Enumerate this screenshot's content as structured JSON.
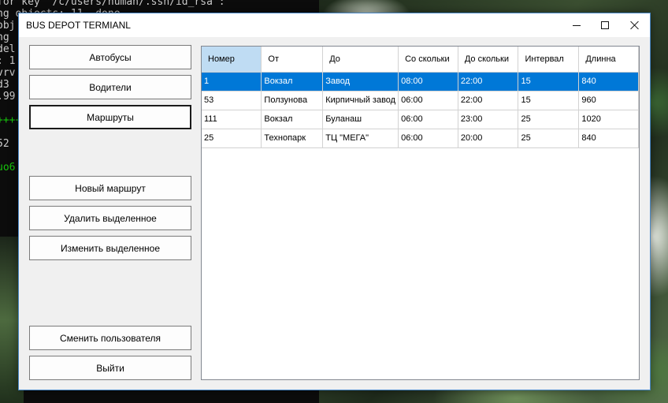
{
  "terminal": {
    "lines": [
      "for key '/c/users/human/.ssh/id_rsa':",
      "ng objects: 11, done.",
      "obj",
      "ng",
      "del",
      ": 1",
      "vrv",
      "d3",
      ".99",
      "++++",
      "52",
      "uo6"
    ]
  },
  "window": {
    "title": "BUS DEPOT TERMIANL"
  },
  "nav": {
    "buses": "Автобусы",
    "drivers": "Водители",
    "routes": "Маршруты"
  },
  "actions": {
    "new_route": "Новый маршрут",
    "delete_selected": "Удалить выделенное",
    "edit_selected": "Изменить выделенное"
  },
  "footer": {
    "switch_user": "Сменить пользователя",
    "exit": "Выйти"
  },
  "routes_table": {
    "columns": [
      "Номер",
      "От",
      "До",
      "Со скольки",
      "До скольки",
      "Интервал",
      "Длинна"
    ],
    "rows": [
      [
        "1",
        "Вокзал",
        "Завод",
        "08:00",
        "22:00",
        "15",
        "840"
      ],
      [
        "53",
        "Ползунова",
        "Кирпичный завод",
        "06:00",
        "22:00",
        "15",
        "960"
      ],
      [
        "111",
        "Вокзал",
        "Буланаш",
        "06:00",
        "23:00",
        "25",
        "1020"
      ],
      [
        "25",
        "Технопарк",
        "ТЦ \"МЕГА\"",
        "06:00",
        "20:00",
        "25",
        "840"
      ]
    ]
  },
  "colors": {
    "selection": "#0078d7",
    "header_selected": "#bfdcf3",
    "window_border": "#4a88c7"
  }
}
